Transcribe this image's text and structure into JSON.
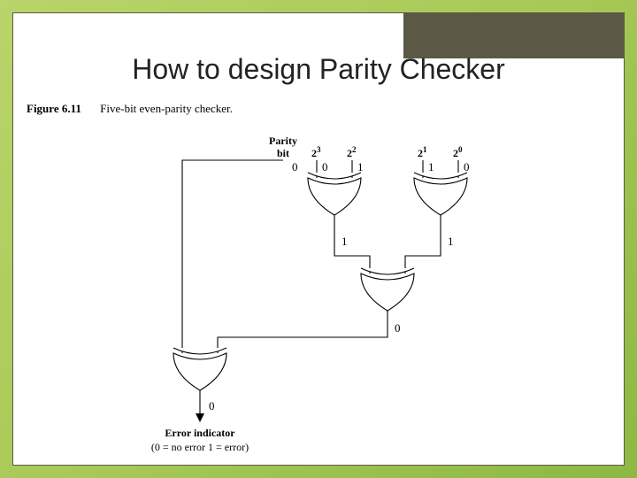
{
  "title": "How to design Parity Checker",
  "figure": {
    "number": "Figure 6.11",
    "caption": "Five-bit even-parity checker.",
    "inputs": {
      "parity_label_line1": "Parity",
      "parity_label_line2": "bit",
      "bit_headers": [
        "2",
        "2",
        "2",
        "2"
      ],
      "bit_exponents": [
        "3",
        "2",
        "1",
        "0"
      ],
      "parity_value": "0",
      "bit_values": [
        "0",
        "1",
        "1",
        "0"
      ]
    },
    "stage1": {
      "gate_a_output": "1",
      "gate_b_output": "1"
    },
    "stage2": {
      "gate_c_output": "0"
    },
    "stage3": {
      "gate_d_output": "0"
    },
    "output": {
      "label": "Error indicator",
      "legend": "(0 = no error   1 = error)"
    }
  }
}
